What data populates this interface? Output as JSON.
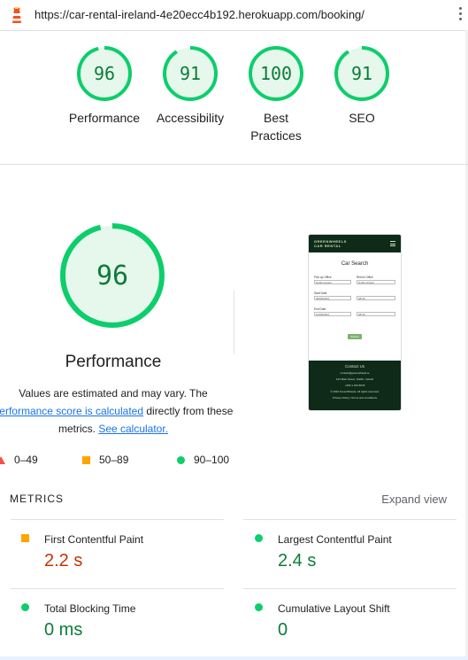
{
  "browser": {
    "url": "https://car-rental-ireland-4e20ecc4b192.herokuapp.com/booking/"
  },
  "summary_scores": [
    {
      "score": "96",
      "label": "Performance"
    },
    {
      "score": "91",
      "label": "Accessibility"
    },
    {
      "score": "100",
      "label": "Best Practices"
    },
    {
      "score": "91",
      "label": "SEO"
    }
  ],
  "performance": {
    "score": "96",
    "title": "Performance",
    "note_prefix": "Values are estimated and may vary. The ",
    "note_link": "performance score is calculated",
    "note_mid": " directly from these metrics. ",
    "calc_link": "See calculator.",
    "legend": [
      {
        "range": "0–49",
        "color": "#ff4e42"
      },
      {
        "range": "50–89",
        "color": "#ffa400"
      },
      {
        "range": "90–100",
        "color": "#0cce6b"
      }
    ]
  },
  "screenshot": {
    "logo_text": "GREENWHEELS",
    "logo_sub": "CAR RENTAL",
    "title": "Car Search",
    "pickup_label": "Pick up Office",
    "pickup_value": "Dublin Airport",
    "return_label": "Return Office",
    "return_value": "Dublin Airport",
    "start_label": "Start Date",
    "start_date": "06/06/2024",
    "start_time": "08:00",
    "end_label": "End Date",
    "end_date": "10/06/2024",
    "end_time": "08:00",
    "button": "Search",
    "footer_title": "Contact Us",
    "footer_email": "contact@greenwheels.ie",
    "footer_address": "123 Main Street, Dublin, Ireland",
    "footer_phone": "+353 1 234 5678",
    "footer_copy": "© 2024 GreenWheels. All rights reserved.",
    "footer_links": "Privacy Policy  |  Terms and Conditions"
  },
  "metrics": {
    "header": "METRICS",
    "expand": "Expand view",
    "items": [
      {
        "name": "First Contentful Paint",
        "value": "2.2 s",
        "status": "average"
      },
      {
        "name": "Largest Contentful Paint",
        "value": "2.4 s",
        "status": "good"
      },
      {
        "name": "Total Blocking Time",
        "value": "0 ms",
        "status": "good"
      },
      {
        "name": "Cumulative Layout Shift",
        "value": "0",
        "status": "good"
      }
    ]
  },
  "colors": {
    "good": "#0cce6b",
    "good_text": "#0c7c3a",
    "average": "#ffa400",
    "average_text": "#c33300",
    "gauge_fill": "#e6f7ec"
  }
}
